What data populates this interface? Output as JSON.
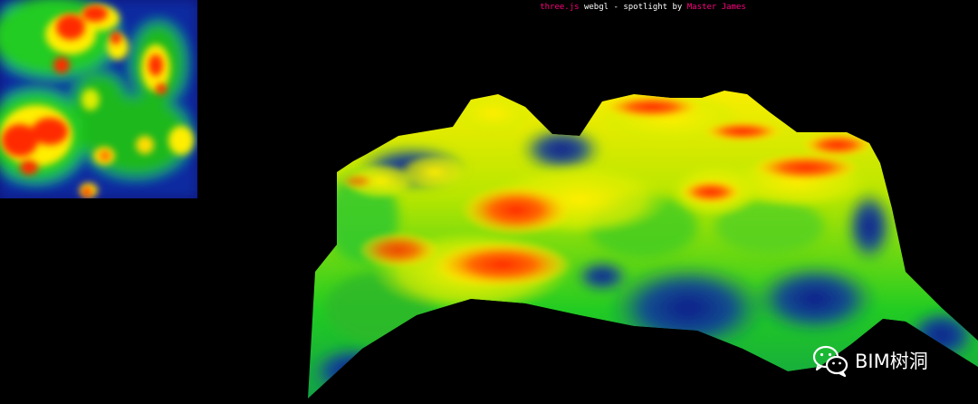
{
  "info": {
    "link_threejs": "three.js",
    "middle_text": " webgl - spotlight by ",
    "link_author": "Master James"
  },
  "watermark": {
    "icon": "wechat-icon",
    "text": "BIM树洞"
  },
  "colors": {
    "background": "#000000",
    "link": "#ff0080",
    "info_text": "#ffffff",
    "terrain_low": "#0a1a8c",
    "terrain_mid": "#22cc22",
    "terrain_high_mid": "#ffee00",
    "terrain_peak": "#ff2a00"
  }
}
